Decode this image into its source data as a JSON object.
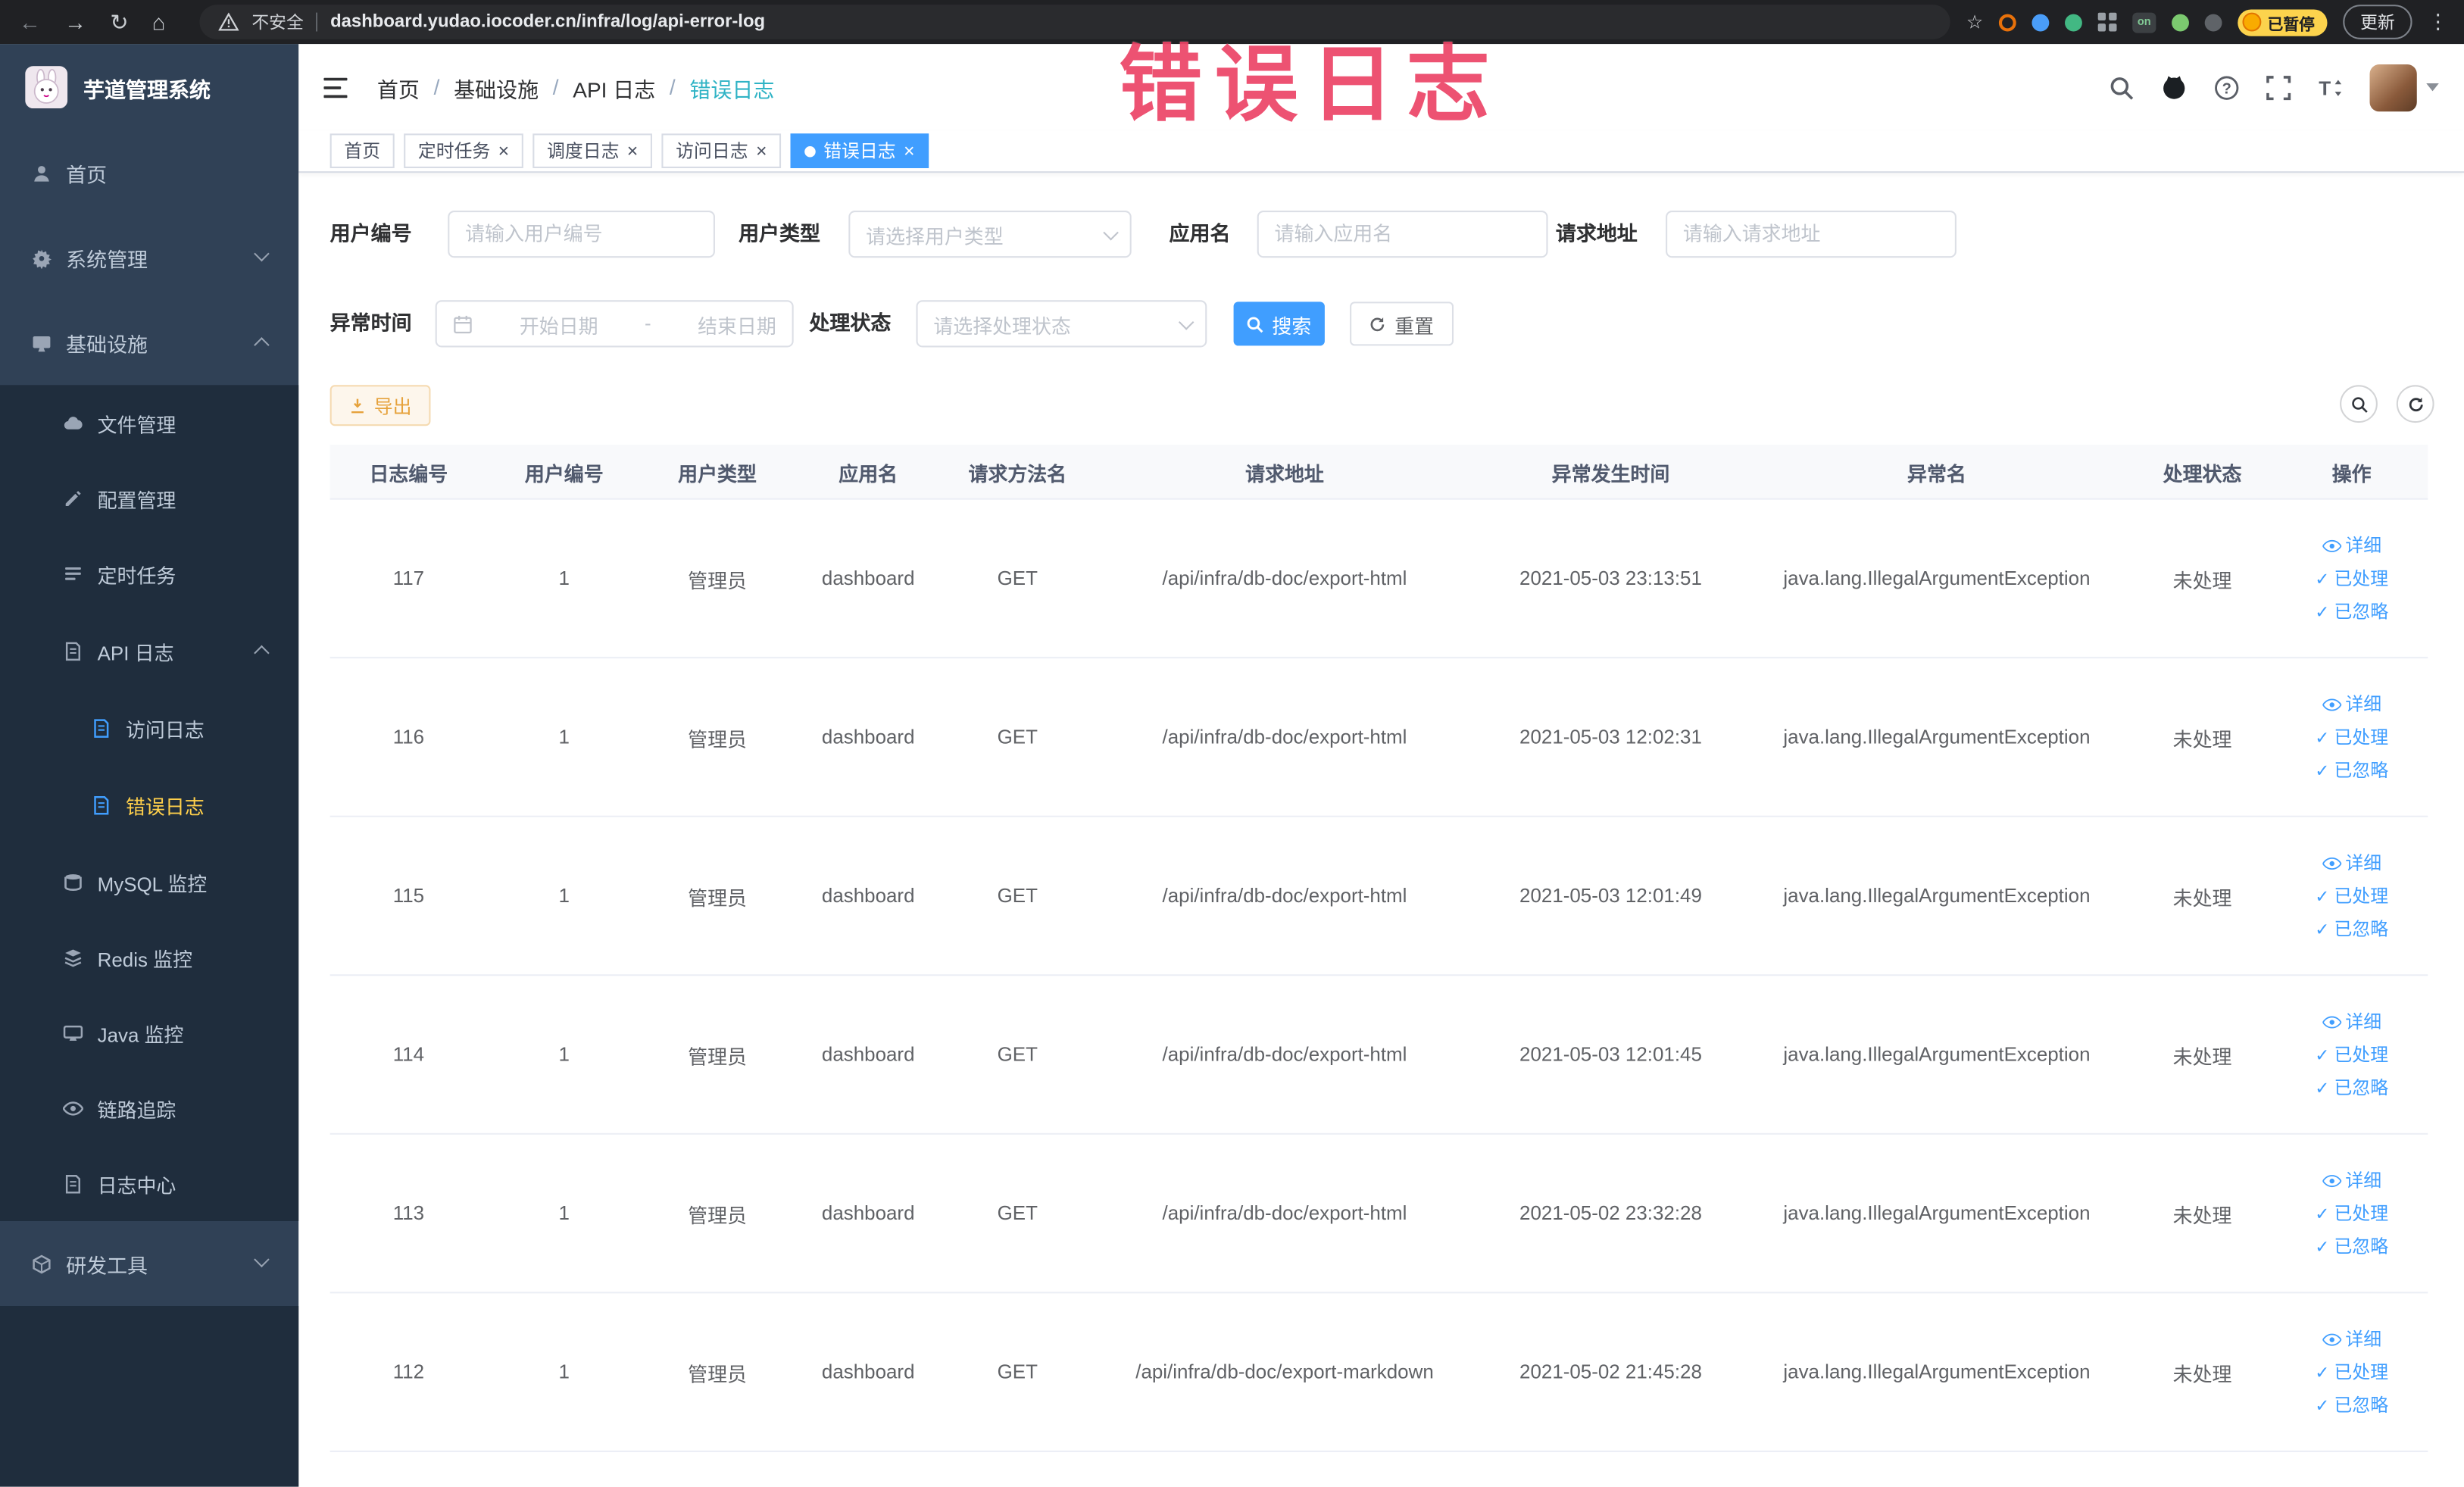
{
  "colors": {
    "accent": "#409EFF",
    "warning": "#E6A23C",
    "sidebar_bg": "#304156",
    "submenu_bg": "#1F2D3D",
    "menu_active_text": "#FFD04B",
    "tag_active_bg": "#409EFF",
    "overlay_text": "#EA3A5E"
  },
  "browser": {
    "security": "不安全",
    "url": "dashboard.yudao.iocoder.cn/infra/log/api-error-log",
    "ext_on_badge": "on",
    "paused_badge": "已暂停",
    "update_button": "更新"
  },
  "overlay": {
    "title": "错误日志"
  },
  "sidebar": {
    "logo_title": "芋道管理系统",
    "items": [
      {
        "label": "首页"
      },
      {
        "label": "系统管理"
      },
      {
        "label": "基础设施",
        "children": [
          {
            "label": "文件管理"
          },
          {
            "label": "配置管理"
          },
          {
            "label": "定时任务"
          },
          {
            "label": "API 日志",
            "children": [
              {
                "label": "访问日志"
              },
              {
                "label": "错误日志"
              }
            ]
          },
          {
            "label": "MySQL 监控"
          },
          {
            "label": "Redis 监控"
          },
          {
            "label": "Java 监控"
          },
          {
            "label": "链路追踪"
          },
          {
            "label": "日志中心"
          }
        ]
      },
      {
        "label": "研发工具"
      }
    ]
  },
  "header": {
    "separator": "/",
    "breadcrumb": [
      "首页",
      "基础设施",
      "API 日志",
      "错误日志"
    ]
  },
  "tags": {
    "items": [
      {
        "label": "首页"
      },
      {
        "label": "定时任务"
      },
      {
        "label": "调度日志"
      },
      {
        "label": "访问日志"
      },
      {
        "label": "错误日志"
      }
    ]
  },
  "filters": {
    "user_id_label": "用户编号",
    "user_id_placeholder": "请输入用户编号",
    "user_type_label": "用户类型",
    "user_type_placeholder": "请选择用户类型",
    "app_name_label": "应用名",
    "app_name_placeholder": "请输入应用名",
    "request_url_label": "请求地址",
    "request_url_placeholder": "请输入请求地址",
    "time_label": "异常时间",
    "time_start_placeholder": "开始日期",
    "time_separator": "-",
    "time_end_placeholder": "结束日期",
    "status_label": "处理状态",
    "status_placeholder": "请选择处理状态",
    "search_button": "搜索",
    "reset_button": "重置"
  },
  "toolbar": {
    "export_button": "导出"
  },
  "table": {
    "columns": [
      "日志编号",
      "用户编号",
      "用户类型",
      "应用名",
      "请求方法名",
      "请求地址",
      "异常发生时间",
      "异常名",
      "处理状态",
      "操作"
    ],
    "actions": {
      "detail": "详细",
      "processed": "已处理",
      "ignored": "已忽略"
    },
    "rows": [
      {
        "id": "117",
        "user_id": "1",
        "user_type": "管理员",
        "app": "dashboard",
        "method": "GET",
        "url": "/api/infra/db-doc/export-html",
        "time": "2021-05-03 23:13:51",
        "exception": "java.lang.IllegalArgumentException",
        "status": "未处理"
      },
      {
        "id": "116",
        "user_id": "1",
        "user_type": "管理员",
        "app": "dashboard",
        "method": "GET",
        "url": "/api/infra/db-doc/export-html",
        "time": "2021-05-03 12:02:31",
        "exception": "java.lang.IllegalArgumentException",
        "status": "未处理"
      },
      {
        "id": "115",
        "user_id": "1",
        "user_type": "管理员",
        "app": "dashboard",
        "method": "GET",
        "url": "/api/infra/db-doc/export-html",
        "time": "2021-05-03 12:01:49",
        "exception": "java.lang.IllegalArgumentException",
        "status": "未处理"
      },
      {
        "id": "114",
        "user_id": "1",
        "user_type": "管理员",
        "app": "dashboard",
        "method": "GET",
        "url": "/api/infra/db-doc/export-html",
        "time": "2021-05-03 12:01:45",
        "exception": "java.lang.IllegalArgumentException",
        "status": "未处理"
      },
      {
        "id": "113",
        "user_id": "1",
        "user_type": "管理员",
        "app": "dashboard",
        "method": "GET",
        "url": "/api/infra/db-doc/export-html",
        "time": "2021-05-02 23:32:28",
        "exception": "java.lang.IllegalArgumentException",
        "status": "未处理"
      },
      {
        "id": "112",
        "user_id": "1",
        "user_type": "管理员",
        "app": "dashboard",
        "method": "GET",
        "url": "/api/infra/db-doc/export-markdown",
        "time": "2021-05-02 21:45:28",
        "exception": "java.lang.IllegalArgumentException",
        "status": "未处理"
      }
    ]
  }
}
